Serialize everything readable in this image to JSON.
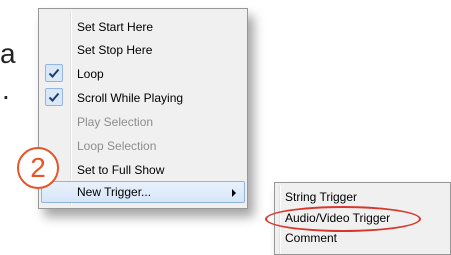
{
  "background_fragments": [
    "a",
    "."
  ],
  "context_menu": {
    "items": [
      {
        "label": "Set Start Here",
        "checked": false,
        "disabled": false
      },
      {
        "label": "Set Stop Here",
        "checked": false,
        "disabled": false
      },
      {
        "label": "Loop",
        "checked": true,
        "disabled": false
      },
      {
        "label": "Scroll While Playing",
        "checked": true,
        "disabled": false
      },
      {
        "label": "Play Selection",
        "checked": false,
        "disabled": true
      },
      {
        "label": "Loop Selection",
        "checked": false,
        "disabled": true
      },
      {
        "label": "Set to Full Show",
        "checked": false,
        "disabled": false
      },
      {
        "label": "New Trigger...",
        "checked": false,
        "disabled": false,
        "has_submenu": true,
        "highlighted": true
      }
    ]
  },
  "submenu": {
    "items": [
      {
        "label": "String Trigger"
      },
      {
        "label": "Audio/Video Trigger",
        "circled": true
      },
      {
        "label": "Comment"
      }
    ]
  },
  "callout": {
    "number": "2",
    "color": "#e4552a"
  },
  "colors": {
    "highlight_border": "#90b4e2",
    "disabled_text": "#8d8d8d",
    "annotation_red": "#d9372b"
  }
}
